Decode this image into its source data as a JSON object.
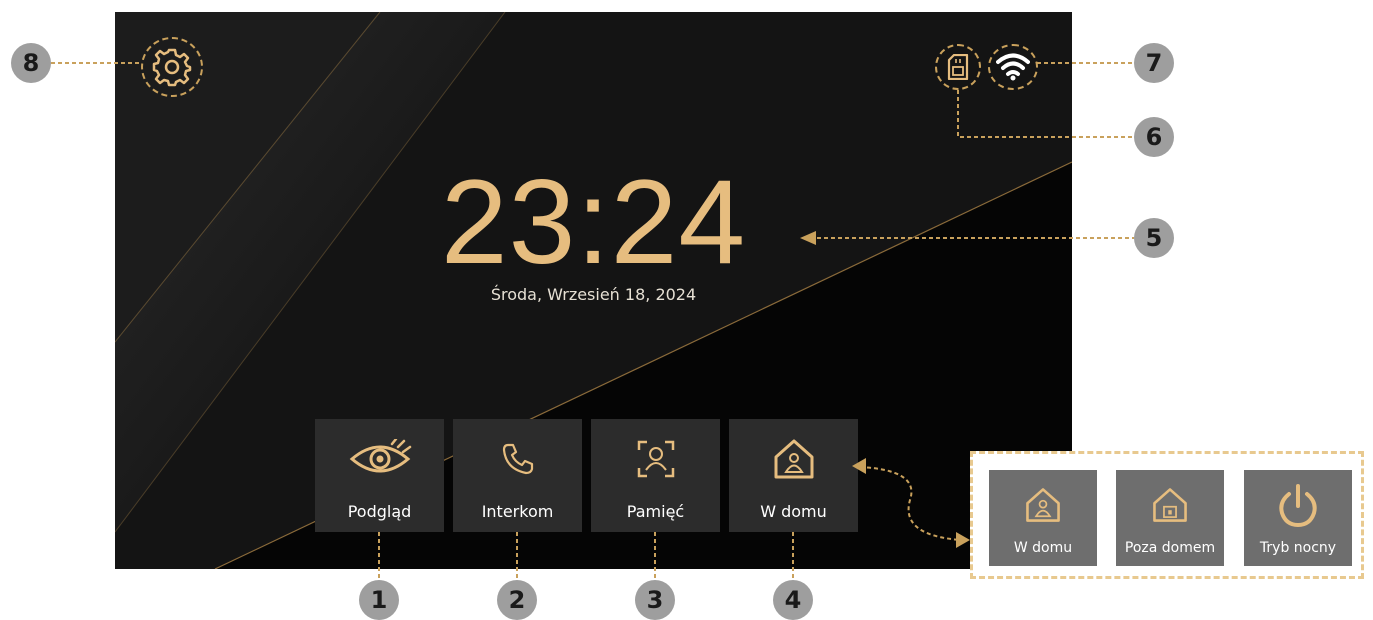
{
  "clock": {
    "time": "23:24",
    "date": "Środa, Wrzesień 18, 2024"
  },
  "menu": [
    {
      "label": "Podgląd",
      "icon": "eye-icon"
    },
    {
      "label": "Interkom",
      "icon": "phone-icon"
    },
    {
      "label": "Pamięć",
      "icon": "face-scan-icon"
    },
    {
      "label": "W domu",
      "icon": "home-person-icon"
    }
  ],
  "status": {
    "sd_icon": "sd-card-icon",
    "wifi_icon": "wifi-icon",
    "settings_icon": "gear-icon"
  },
  "callouts": [
    "1",
    "2",
    "3",
    "4",
    "5",
    "6",
    "7",
    "8"
  ],
  "modes": [
    {
      "label": "W domu",
      "icon": "home-person-icon"
    },
    {
      "label": "Poza domem",
      "icon": "home-lock-icon"
    },
    {
      "label": "Tryb nocny",
      "icon": "power-icon"
    }
  ],
  "colors": {
    "accent": "#e6bd7f",
    "tile": "#2c2c2c",
    "mode_tile": "#6e6e6e",
    "callout": "#9e9e9e"
  }
}
